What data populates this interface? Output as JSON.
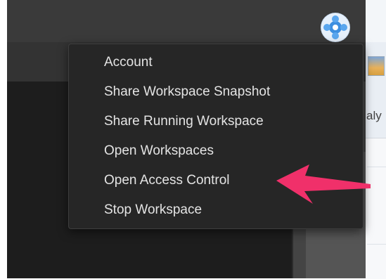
{
  "menu": {
    "items": [
      {
        "label": "Account"
      },
      {
        "label": "Share Workspace Snapshot"
      },
      {
        "label": "Share Running Workspace"
      },
      {
        "label": "Open Workspaces"
      },
      {
        "label": "Open Access Control"
      },
      {
        "label": "Stop Workspace"
      }
    ]
  },
  "background_window": {
    "partial_label": "aly"
  },
  "annotation": {
    "arrow_color": "#f0306a",
    "points_to": "Open Access Control"
  },
  "avatar": {
    "icon": "user-avatar-icon"
  }
}
